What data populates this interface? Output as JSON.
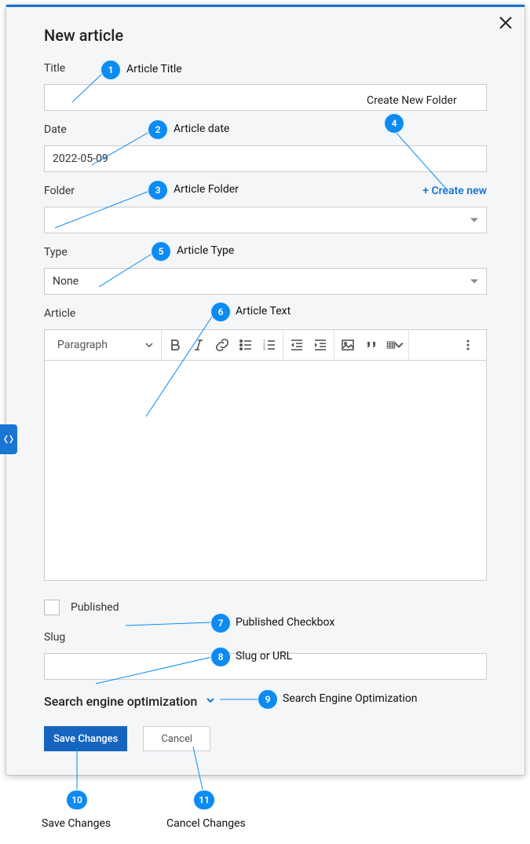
{
  "modal": {
    "title": "New article",
    "fields": {
      "title_label": "Title",
      "date_label": "Date",
      "date_value": "2022-05-09",
      "folder_label": "Folder",
      "create_new": "+ Create new",
      "create_new_folder_tip": "Create New Folder",
      "type_label": "Type",
      "type_value": "None",
      "article_label": "Article",
      "published_label": "Published",
      "slug_label": "Slug",
      "seo_label": "Search engine optimization"
    },
    "editor": {
      "paragraph_label": "Paragraph"
    },
    "actions": {
      "save": "Save Changes",
      "cancel": "Cancel"
    }
  },
  "annotations": {
    "a1": "Article Title",
    "a2": "Article date",
    "a3": "Article Folder",
    "a4": "Create New Folder",
    "a5": "Article Type",
    "a6": "Article Text",
    "a7": "Published Checkbox",
    "a8": "Slug or URL",
    "a9": "Search Engine Optimization",
    "a10": "Save Changes",
    "a11": "Cancel Changes"
  }
}
